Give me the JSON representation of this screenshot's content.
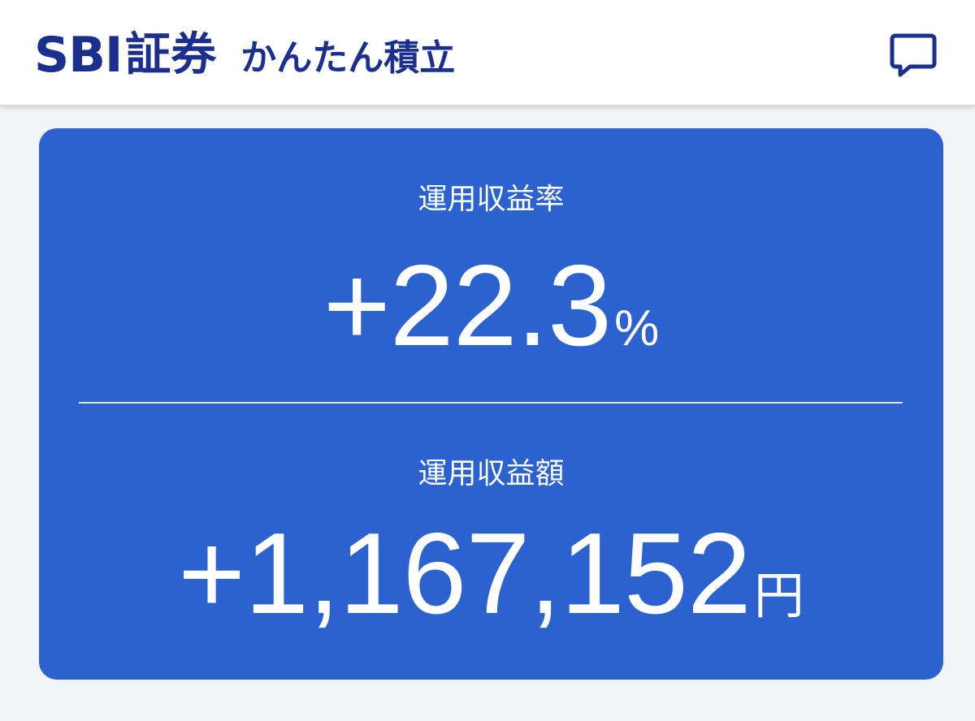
{
  "header": {
    "brand": "SBI",
    "brand_jp": "証券",
    "service_name": "かんたん積立",
    "chat_icon": "chat-bubble-icon"
  },
  "colors": {
    "brand_navy": "#1b2f8f",
    "card_blue": "#2c62cf",
    "page_bg": "#f3f4f8"
  },
  "summary": {
    "return_rate": {
      "label": "運用収益率",
      "value": "+22.3",
      "unit": "%"
    },
    "return_amount": {
      "label": "運用収益額",
      "value": "+1,167,152",
      "unit": "円"
    }
  }
}
